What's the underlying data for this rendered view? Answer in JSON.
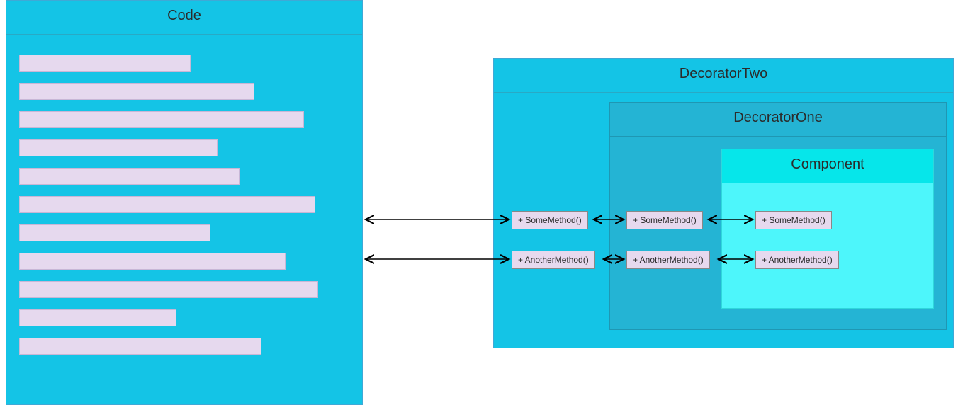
{
  "code": {
    "title": "Code",
    "line_widths": [
      240,
      330,
      400,
      278,
      310,
      416,
      268,
      374,
      420,
      220,
      340
    ]
  },
  "decorator_two": {
    "title": "DecoratorTwo",
    "methods": [
      "+ SomeMethod()",
      "+ AnotherMethod()"
    ]
  },
  "decorator_one": {
    "title": "DecoratorOne",
    "methods": [
      "+ SomeMethod()",
      "+ AnotherMethod()"
    ]
  },
  "component": {
    "title": "Component",
    "methods": [
      "+ SomeMethod()",
      "+ AnotherMethod()"
    ]
  },
  "colors": {
    "outer": "#14c4e6",
    "mid": "#24b4d4",
    "inner_body": "#4df6fb",
    "inner_head": "#06e6ea",
    "method_fill": "#e6d9ee"
  }
}
